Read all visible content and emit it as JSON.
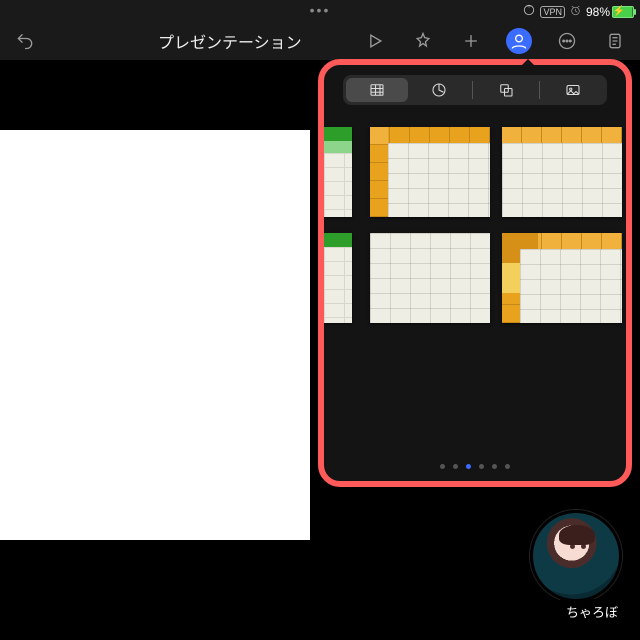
{
  "status": {
    "vpn_label": "VPN",
    "battery_text": "98%"
  },
  "toolbar": {
    "title": "プレゼンテーション"
  },
  "popover": {
    "page_dots": {
      "count": 6,
      "active_index": 2
    }
  },
  "avatar": {
    "name": "ちゃろぼ"
  }
}
